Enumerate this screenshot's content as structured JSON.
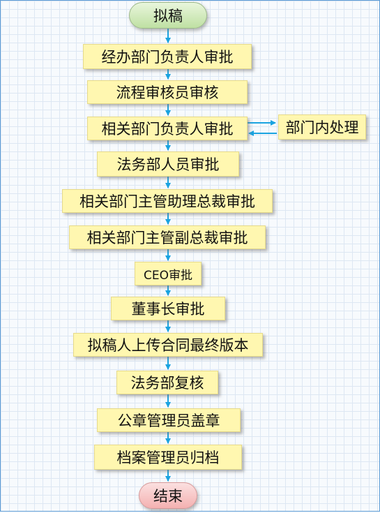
{
  "start": "拟稿",
  "steps": [
    "经办部门负责人审批",
    "流程审核员审核",
    "相关部门负责人审批",
    "法务部人员审批",
    "相关部门主管助理总裁审批",
    "相关部门主管副总裁审批",
    "CEO审批",
    "董事长审批",
    "拟稿人上传合同最终版本",
    "法务部复核",
    "公章管理员盖章",
    "档案管理员归档"
  ],
  "side": "部门内处理",
  "end": "结束",
  "colors": {
    "step_fill": "#fff7b0",
    "arrow": "#1aa3e0",
    "start_fill": "#cfe8b8",
    "end_fill": "#f6c2c2"
  }
}
